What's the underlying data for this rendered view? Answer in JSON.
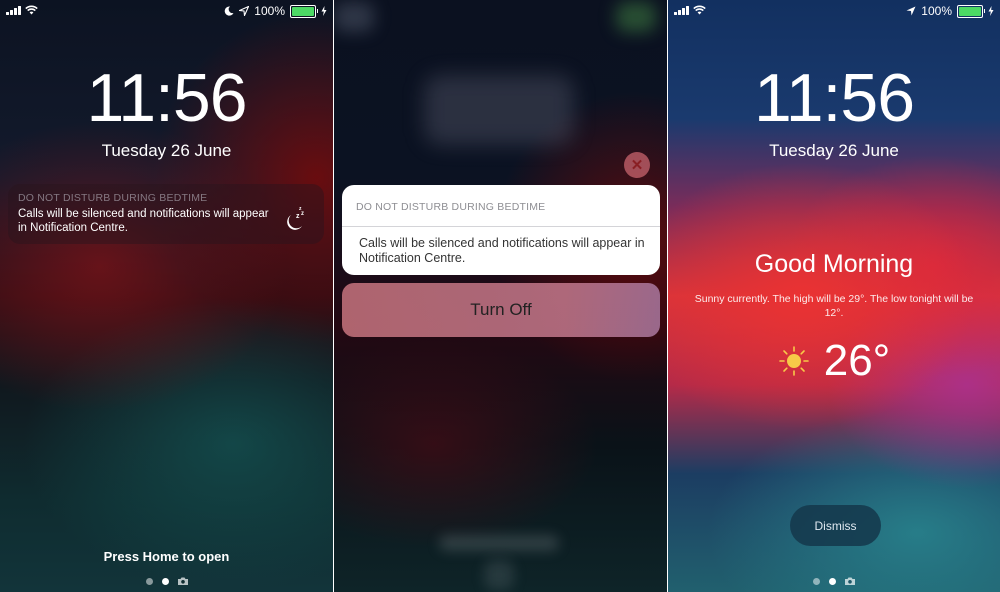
{
  "panels": {
    "lock_dnd": {
      "status": {
        "battery_pct": "100%",
        "battery_level": 1.0,
        "icons": [
          "signal-icon",
          "wifi-icon",
          "moon-icon",
          "location-arrow-icon",
          "battery-icon",
          "charging-bolt-icon"
        ]
      },
      "time": "11:56",
      "date": "Tuesday 26 June",
      "notification": {
        "title": "DO NOT DISTURB DURING BEDTIME",
        "body": "Calls will be silenced and notifications will appear in Notification Centre.",
        "icon": "moon-zzz-icon"
      },
      "unlock_hint": "Press Home to open",
      "page_indicator": {
        "pages": 2,
        "active": 1,
        "camera": true
      }
    },
    "dnd_expanded": {
      "close_icon": "close-icon",
      "card": {
        "title": "DO NOT DISTURB DURING BEDTIME",
        "body": "Calls will be silenced and notifications will appear in Notification Centre."
      },
      "action": "Turn Off"
    },
    "good_morning": {
      "status": {
        "battery_pct": "100%",
        "battery_level": 1.0,
        "icons": [
          "signal-icon",
          "wifi-icon",
          "location-arrow-icon",
          "battery-icon",
          "charging-bolt-icon"
        ]
      },
      "time": "11:56",
      "date": "Tuesday 26 June",
      "greeting": "Good Morning",
      "forecast": "Sunny currently. The high will be 29°. The low tonight will be 12°.",
      "weather_icon": "sun-icon",
      "temperature": "26°",
      "dismiss": "Dismiss",
      "page_indicator": {
        "pages": 2,
        "active": 1,
        "camera": true
      }
    }
  },
  "colors": {
    "battery_fill": "#4cd964",
    "sun": "#f7c948",
    "close_x": "#8a1f24"
  }
}
